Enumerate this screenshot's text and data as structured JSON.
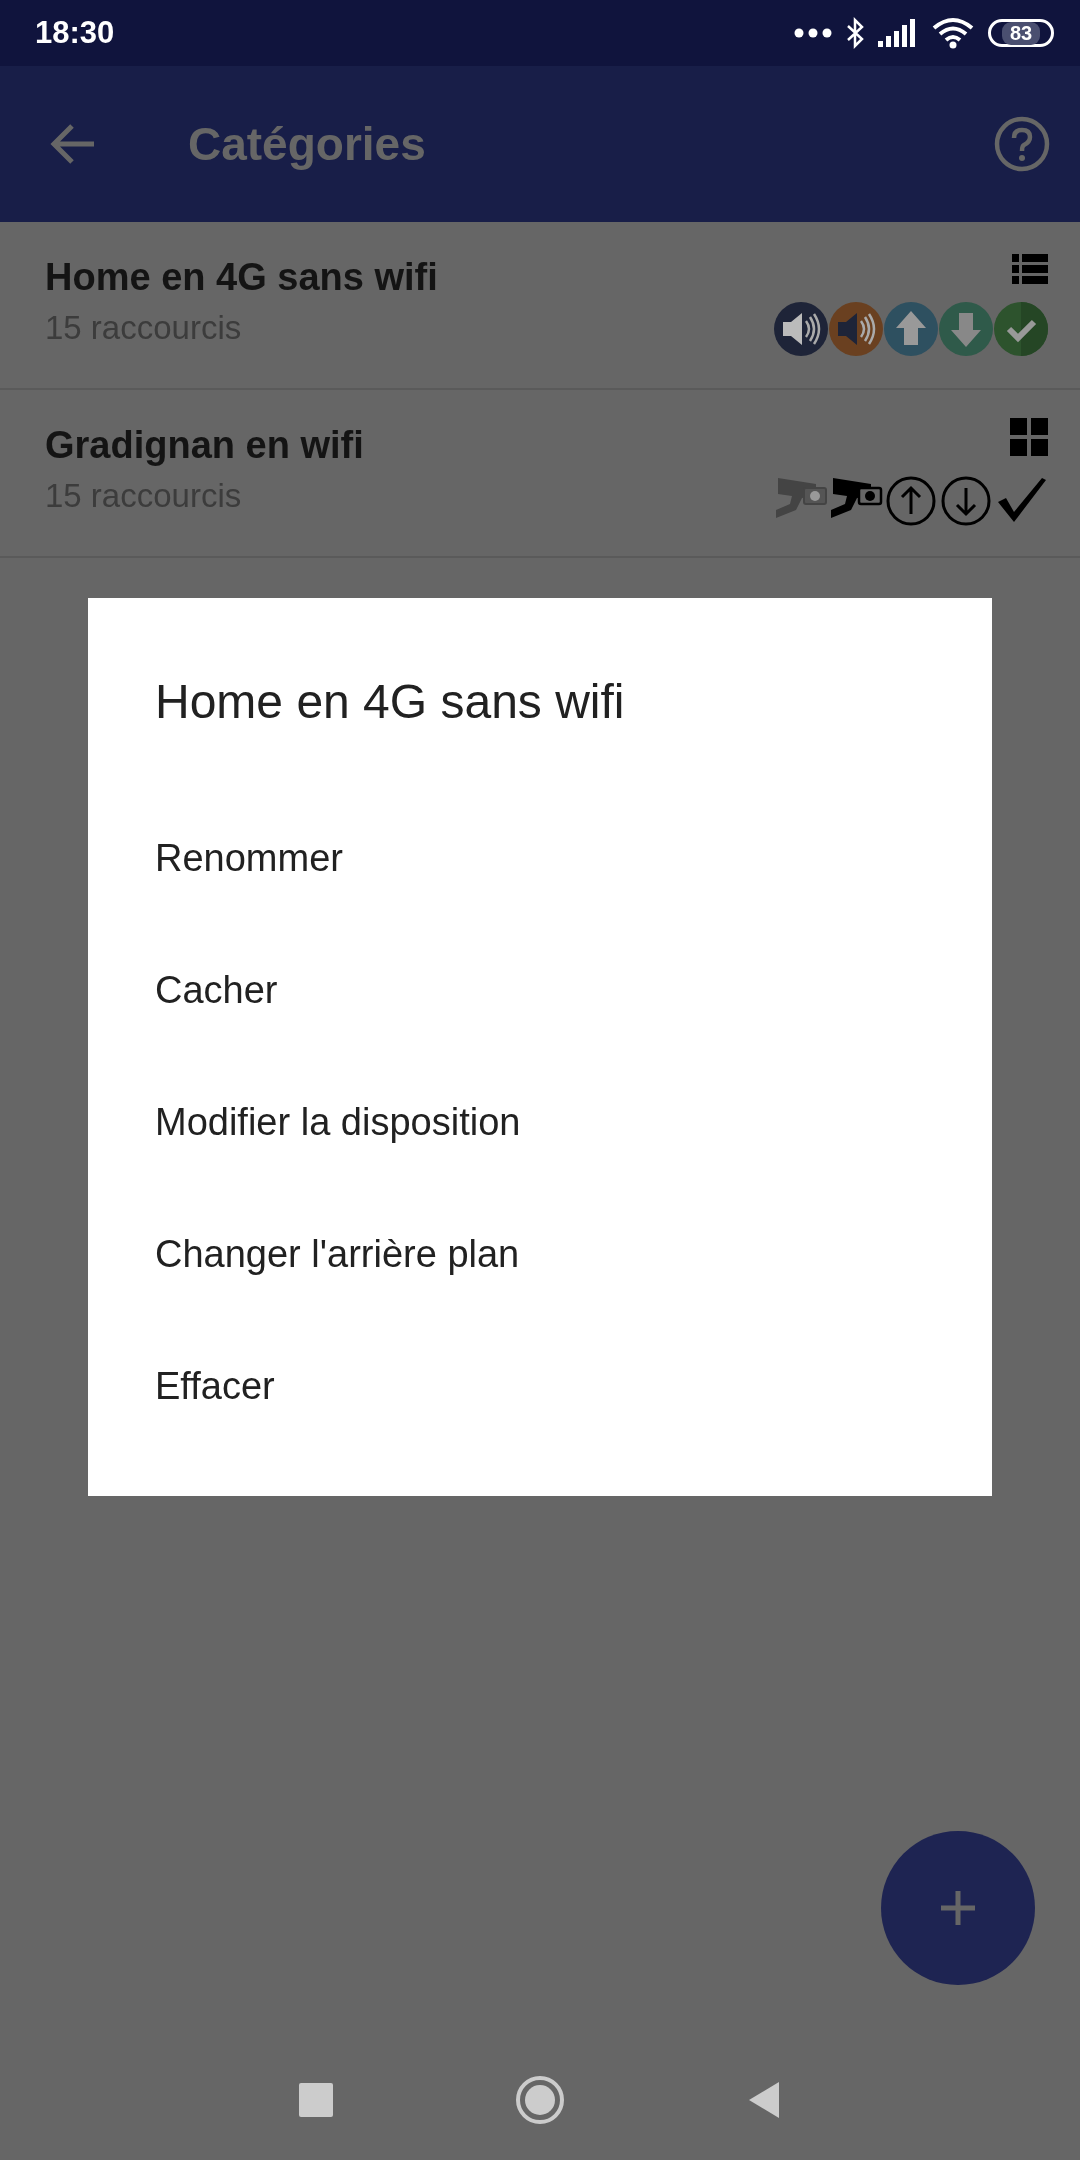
{
  "status_bar": {
    "time": "18:30",
    "battery": "83"
  },
  "app_bar": {
    "title": "Catégories"
  },
  "categories": [
    {
      "name": "Home en 4G sans wifi",
      "count": "15 raccourcis",
      "kind": "list"
    },
    {
      "name": "Gradignan en wifi",
      "count": "15 raccourcis",
      "kind": "grid"
    }
  ],
  "dialog": {
    "title": "Home en 4G sans wifi",
    "items": [
      "Renommer",
      "Cacher",
      "Modifier la disposition",
      "Changer l'arrière plan",
      "Effacer"
    ]
  }
}
